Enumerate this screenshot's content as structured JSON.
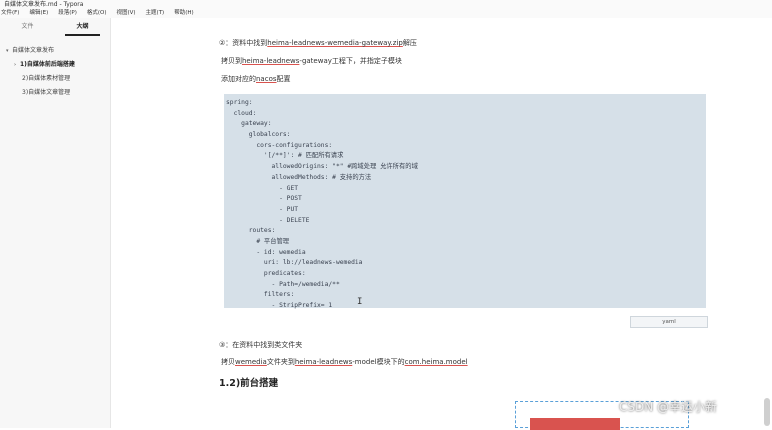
{
  "window": {
    "title": "自媒体文章发布.md - Typora"
  },
  "menu": [
    "文件(F)",
    "编辑(E)",
    "段落(P)",
    "格式(O)",
    "视图(V)",
    "主题(T)",
    "帮助(H)"
  ],
  "sidebar": {
    "tabs": [
      "文件",
      "大纲"
    ],
    "active_tab": "大纲",
    "outline": [
      {
        "label": "自媒体文章发布",
        "level": 1,
        "bold": false
      },
      {
        "label": "1)自媒体前后端搭建",
        "level": 2,
        "bold": true
      },
      {
        "label": "2)自媒体素材管理",
        "level": 3,
        "bold": false
      },
      {
        "label": "3)自媒体文章管理",
        "level": 3,
        "bold": false
      }
    ]
  },
  "doc": {
    "step2": {
      "num": "②：",
      "pre": "资料中找到",
      "link": "heima-leadnews-wemedia-gateway.zip",
      "post": "解压"
    },
    "copy1": {
      "pre": "拷贝到",
      "link": "heima-leadnews",
      "post": "-gateway工程下，并指定子模块"
    },
    "nacos": {
      "pre": "添加对应的",
      "link": "nacos",
      "post": "配置"
    },
    "code_lines": [
      "spring:",
      "  cloud:",
      "    gateway:",
      "      globalcors:",
      "        cors-configurations:",
      "          '[/**]': # 匹配所有请求",
      "            allowedOrigins: \"*\" #跨域处理 允许所有的域",
      "            allowedMethods: # 支持的方法",
      "              - GET",
      "              - POST",
      "              - PUT",
      "              - DELETE",
      "      routes:",
      "        # 平台管理",
      "        - id: wemedia",
      "          uri: lb://leadnews-wemedia",
      "          predicates:",
      "            - Path=/wemedia/**",
      "          filters:",
      "            - StripPrefix= 1"
    ],
    "code_lang": "yaml",
    "step3": {
      "num": "③：",
      "text": "在资料中找到类文件夹"
    },
    "copy2": {
      "pre": "拷贝",
      "link1": "wemedia",
      "mid1": "文件夹到",
      "link2": "heima-leadnews",
      "mid2": "-model模块下的",
      "link3": "com.heima.model"
    },
    "heading": "1.2)前台搭建"
  },
  "watermark": "CSDN @幸运小新",
  "colors": {
    "code_bg": "#d6e0e8",
    "underline": "#d9534f",
    "accent_red": "#d9534f",
    "dashed": "#5aa0d8"
  }
}
